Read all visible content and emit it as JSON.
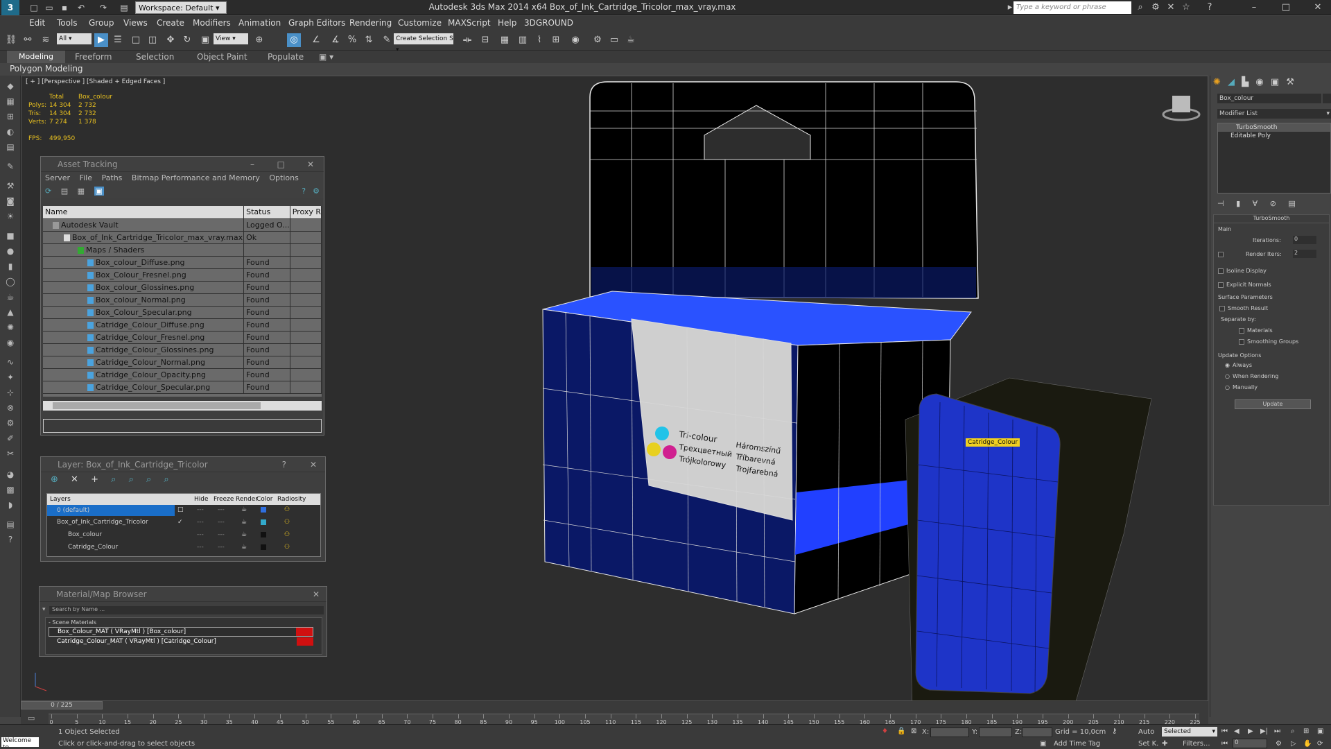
{
  "title_bar": {
    "workspace": "Workspace: Default",
    "window_title": "Autodesk 3ds Max  2014 x64      Box_of_Ink_Cartridge_Tricolor_max_vray.max",
    "search_placeholder": "Type a keyword or phrase"
  },
  "menu": [
    "Edit",
    "Tools",
    "Group",
    "Views",
    "Create",
    "Modifiers",
    "Animation",
    "Graph Editors",
    "Rendering",
    "Customize",
    "MAXScript",
    "Help",
    "3DGROUND"
  ],
  "toolbar": {
    "filter": "All",
    "refcoord": "View",
    "selection_set": "Create Selection S"
  },
  "ribbon": {
    "tabs": [
      "Modeling",
      "Freeform",
      "Selection",
      "Object Paint",
      "Populate"
    ],
    "sub": "Polygon Modeling"
  },
  "viewport": {
    "label": "[ + ] [Perspective ] [Shaded + Edged Faces ]",
    "stats": {
      "h_total": "Total",
      "h_obj": "Box_colour",
      "polys_l": "Polys:",
      "polys_t": "14 304",
      "polys_o": "2 732",
      "tris_l": "Tris:",
      "tris_t": "14 304",
      "tris_o": "2 732",
      "verts_l": "Verts:",
      "verts_t": "7 274",
      "verts_o": "1 378",
      "fps_l": "FPS:",
      "fps_v": "499,950"
    },
    "tooltip": "Catridge_Colour",
    "text1": "Tri-colour",
    "text2": "Трехцветный",
    "text3": "Trójkolorowy",
    "text4": "Háromszínű",
    "text5": "Tříbarevná",
    "text6": "Trojfarebná"
  },
  "asset_tracking": {
    "title": "Asset Tracking",
    "menu": [
      "Server",
      "File",
      "Paths",
      "Bitmap Performance and Memory",
      "Options"
    ],
    "cols": [
      "Name",
      "Status",
      "Proxy R"
    ],
    "rows": [
      {
        "name": "Autodesk Vault",
        "status": "Logged O..."
      },
      {
        "name": "Box_of_Ink_Cartridge_Tricolor_max_vray.max",
        "status": "Ok"
      },
      {
        "name": "Maps / Shaders",
        "status": ""
      },
      {
        "name": "Box_colour_Diffuse.png",
        "status": "Found"
      },
      {
        "name": "Box_Colour_Fresnel.png",
        "status": "Found"
      },
      {
        "name": "Box_colour_Glossines.png",
        "status": "Found"
      },
      {
        "name": "Box_colour_Normal.png",
        "status": "Found"
      },
      {
        "name": "Box_Colour_Specular.png",
        "status": "Found"
      },
      {
        "name": "Catridge_Colour_Diffuse.png",
        "status": "Found"
      },
      {
        "name": "Catridge_Colour_Fresnel.png",
        "status": "Found"
      },
      {
        "name": "Catridge_Colour_Glossines.png",
        "status": "Found"
      },
      {
        "name": "Catridge_Colour_Normal.png",
        "status": "Found"
      },
      {
        "name": "Catridge_Colour_Opacity.png",
        "status": "Found"
      },
      {
        "name": "Catridge_Colour_Specular.png",
        "status": "Found"
      }
    ]
  },
  "layer": {
    "title": "Layer: Box_of_Ink_Cartridge_Tricolor",
    "help": "?",
    "cols": [
      "Layers",
      "Hide",
      "Freeze",
      "Render",
      "Color",
      "Radiosity"
    ],
    "rows": [
      "0 (default)",
      "Box_of_Ink_Cartridge_Tricolor",
      "Box_colour",
      "Catridge_Colour"
    ],
    "dash": "---"
  },
  "material_browser": {
    "title": "Material/Map Browser",
    "search": "Search by Name ...",
    "section": "- Scene Materials",
    "items": [
      "Box_Colour_MAT ( VRayMtl ) [Box_colour]",
      "Catridge_Colour_MAT ( VRayMtl ) [Catridge_Colour]"
    ]
  },
  "command_panel": {
    "object_name": "Box_colour",
    "modifier_list": "Modifier List",
    "stack": [
      "TurboSmooth",
      "Editable Poly"
    ],
    "rollout": "TurboSmooth",
    "main": "Main",
    "iterations_l": "Iterations:",
    "iterations_v": "0",
    "render_iters_l": "Render Iters:",
    "render_iters_v": "2",
    "isoline": "Isoline Display",
    "explicit": "Explicit Normals",
    "surface": "Surface Parameters",
    "smooth_result": "Smooth Result",
    "separate": "Separate by:",
    "materials": "Materials",
    "smoothing": "Smoothing Groups",
    "update_opts": "Update Options",
    "always": "Always",
    "when_rendering": "When Rendering",
    "manually": "Manually",
    "update": "Update"
  },
  "timeline": {
    "frame": "0 / 225",
    "ticks": [
      "0",
      "5",
      "10",
      "15",
      "20",
      "25",
      "30",
      "35",
      "40",
      "45",
      "50",
      "55",
      "60",
      "65",
      "70",
      "75",
      "80",
      "85",
      "90",
      "95",
      "100",
      "105",
      "110",
      "115",
      "120",
      "125",
      "130",
      "135",
      "140",
      "145",
      "150",
      "155",
      "160",
      "165",
      "170",
      "175",
      "180",
      "185",
      "190",
      "195",
      "200",
      "205",
      "210",
      "215",
      "220",
      "225"
    ]
  },
  "status": {
    "welcome": "Welcome to",
    "selected": "1 Object Selected",
    "hint": "Click or click-and-drag to select objects",
    "x": "X:",
    "y": "Y:",
    "z": "Z:",
    "grid": "Grid = 10,0cm",
    "addtag": "Add Time Tag",
    "auto": "Auto",
    "setk": "Set K.",
    "sel_dd": "Selected",
    "filters": "Filters...",
    "frame": "0"
  }
}
